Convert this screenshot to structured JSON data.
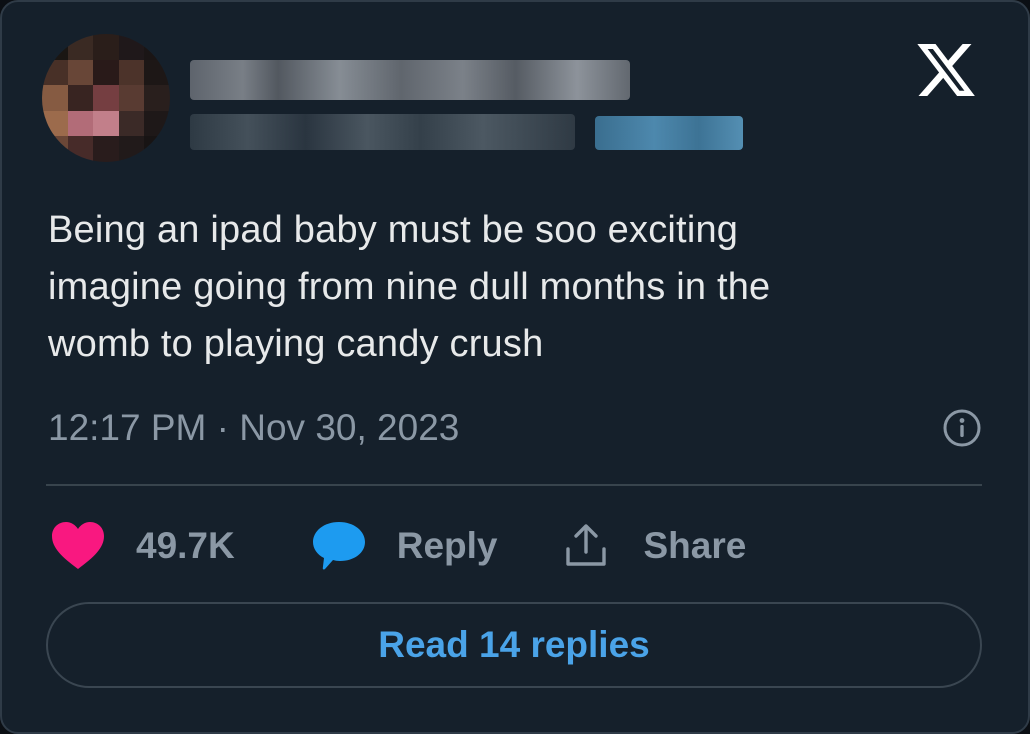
{
  "tweet": {
    "text": "Being an ipad baby must be soo exciting\nimagine going from nine dull months in the\nwomb to playing candy crush",
    "timestamp": "12:17 PM · Nov 30, 2023"
  },
  "header": {
    "logo_icon": "x-logo-icon"
  },
  "actions": {
    "like_count": "49.7K",
    "reply_label": "Reply",
    "share_label": "Share"
  },
  "footer": {
    "read_replies_label": "Read 14 replies"
  },
  "colors": {
    "background": "#15202b",
    "text": "#e7e9ea",
    "muted": "#8b98a5",
    "like": "#f91880",
    "accent": "#1d9bf0"
  }
}
